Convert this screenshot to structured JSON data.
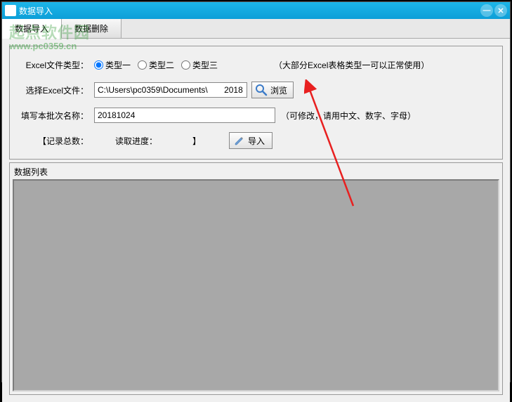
{
  "window": {
    "title": "数据导入"
  },
  "watermark": {
    "text": "起点软件园",
    "url": "www.pc0359.cn"
  },
  "tabs": {
    "import": "数据导入",
    "delete": "数据删除"
  },
  "form": {
    "file_type_label": "Excel文件类型：",
    "type1": "类型一",
    "type2": "类型二",
    "type3": "类型三",
    "file_type_hint": "（大部分Excel表格类型一可以正常使用）",
    "select_file_label": "选择Excel文件：",
    "file_path": "C:\\Users\\pc0359\\Documents\\       2018",
    "browse_button": "浏览",
    "batch_label": "填写本批次名称：",
    "batch_value": "20181024",
    "batch_hint": "（可修改，请用中文、数字、字母）",
    "record_count_label": "【记录总数：",
    "progress_label": "读取进度：",
    "progress_close": "】",
    "import_button": "导入"
  },
  "list": {
    "caption": "数据列表"
  }
}
